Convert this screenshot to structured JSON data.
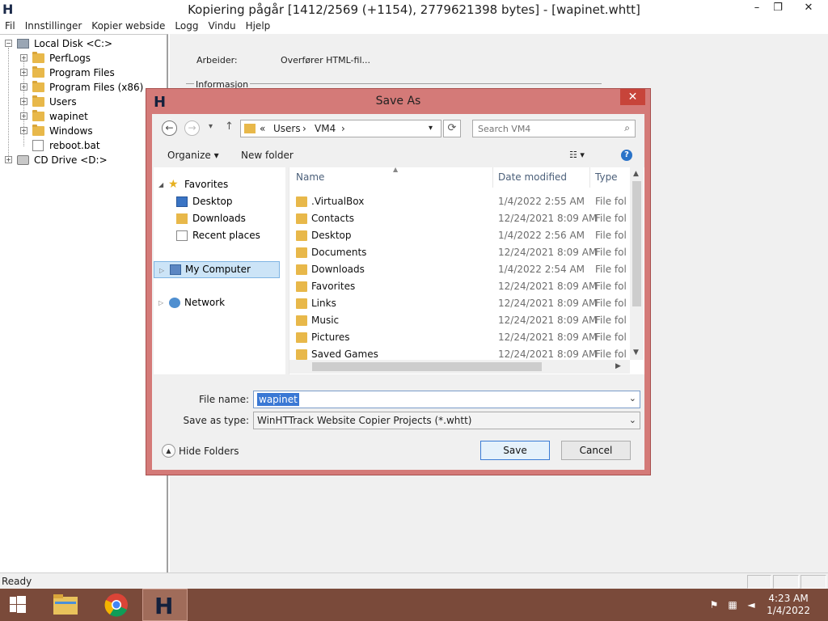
{
  "app": {
    "title": "Kopiering pågår [1412/2569 (+1154), 2779621398 bytes] - [wapinet.whtt]",
    "logo": "H",
    "window_controls": {
      "minimize": "–",
      "maximize": "❐",
      "close": "✕"
    },
    "menu": [
      "Fil",
      "Innstillinger",
      "Kopier webside",
      "Logg",
      "Vindu",
      "Hjelp"
    ]
  },
  "tree": [
    {
      "label": "Local Disk <C:>",
      "toggle": "−"
    },
    {
      "label": "PerfLogs",
      "toggle": "+"
    },
    {
      "label": "Program Files",
      "toggle": "+"
    },
    {
      "label": "Program Files (x86)",
      "toggle": "+"
    },
    {
      "label": "Users",
      "toggle": "+"
    },
    {
      "label": "wapinet",
      "toggle": "+"
    },
    {
      "label": "Windows",
      "toggle": "+"
    },
    {
      "label": "reboot.bat",
      "toggle": ""
    },
    {
      "label": "CD Drive <D:>",
      "toggle": "+"
    }
  ],
  "right_pane": {
    "worker_label": "Arbeider:",
    "worker_value": "Overfører HTML-fil...",
    "info_group": "Informasjon"
  },
  "status": {
    "text": "Ready"
  },
  "dialog": {
    "title": "Save As",
    "logo": "H",
    "close": "✕",
    "address": {
      "prefix": "«",
      "crumbs": [
        "Users",
        "VM4"
      ],
      "sep": "›"
    },
    "search_placeholder": "Search VM4",
    "organize": "Organize ▾",
    "new_folder": "New folder",
    "help": "?",
    "nav": {
      "favorites": "Favorites",
      "desktop": "Desktop",
      "downloads": "Downloads",
      "recent": "Recent places",
      "my_computer": "My Computer",
      "network": "Network"
    },
    "columns": {
      "name": "Name",
      "date": "Date modified",
      "type": "Type"
    },
    "files": [
      {
        "name": ".VirtualBox",
        "date": "1/4/2022 2:55 AM",
        "type": "File fol"
      },
      {
        "name": "Contacts",
        "date": "12/24/2021 8:09 AM",
        "type": "File fol"
      },
      {
        "name": "Desktop",
        "date": "1/4/2022 2:56 AM",
        "type": "File fol"
      },
      {
        "name": "Documents",
        "date": "12/24/2021 8:09 AM",
        "type": "File fol"
      },
      {
        "name": "Downloads",
        "date": "1/4/2022 2:54 AM",
        "type": "File fol"
      },
      {
        "name": "Favorites",
        "date": "12/24/2021 8:09 AM",
        "type": "File fol"
      },
      {
        "name": "Links",
        "date": "12/24/2021 8:09 AM",
        "type": "File fol"
      },
      {
        "name": "Music",
        "date": "12/24/2021 8:09 AM",
        "type": "File fol"
      },
      {
        "name": "Pictures",
        "date": "12/24/2021 8:09 AM",
        "type": "File fol"
      },
      {
        "name": "Saved Games",
        "date": "12/24/2021 8:09 AM",
        "type": "File fol"
      }
    ],
    "file_name_label": "File name:",
    "file_name_value": "wapinet",
    "save_type_label": "Save as type:",
    "save_type_value": "WinHTTrack Website Copier Projects (*.whtt)",
    "hide_folders": "Hide Folders",
    "save": "Save",
    "cancel": "Cancel"
  },
  "taskbar": {
    "time": "4:23 AM",
    "date": "1/4/2022",
    "active_app": "H"
  }
}
